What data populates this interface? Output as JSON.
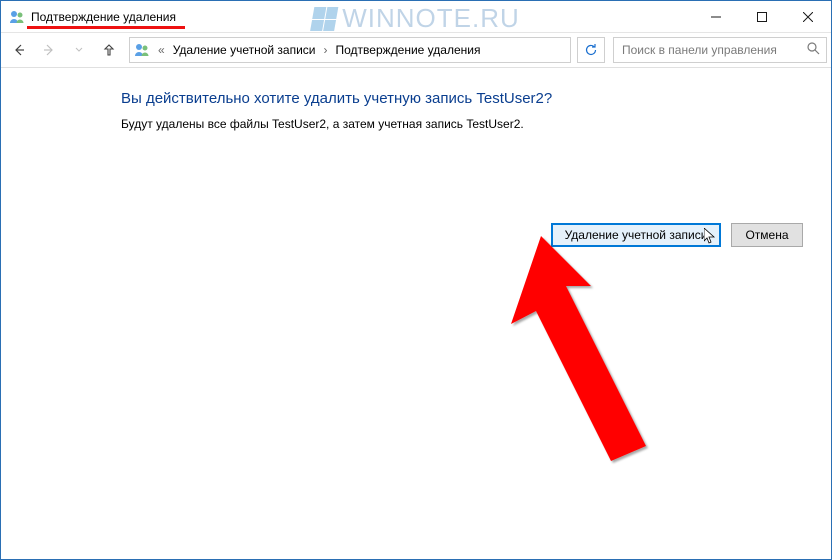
{
  "window": {
    "title": "Подтверждение удаления"
  },
  "watermark": "WINNOTE.RU",
  "breadcrumb": {
    "item1": "Удаление учетной записи",
    "item2": "Подтверждение удаления"
  },
  "search": {
    "placeholder": "Поиск в панели управления"
  },
  "content": {
    "heading": "Вы действительно хотите удалить учетную запись TestUser2?",
    "description": "Будут удалены все файлы TestUser2, а затем учетная запись TestUser2."
  },
  "buttons": {
    "delete": "Удаление учетной записи",
    "cancel": "Отмена"
  }
}
